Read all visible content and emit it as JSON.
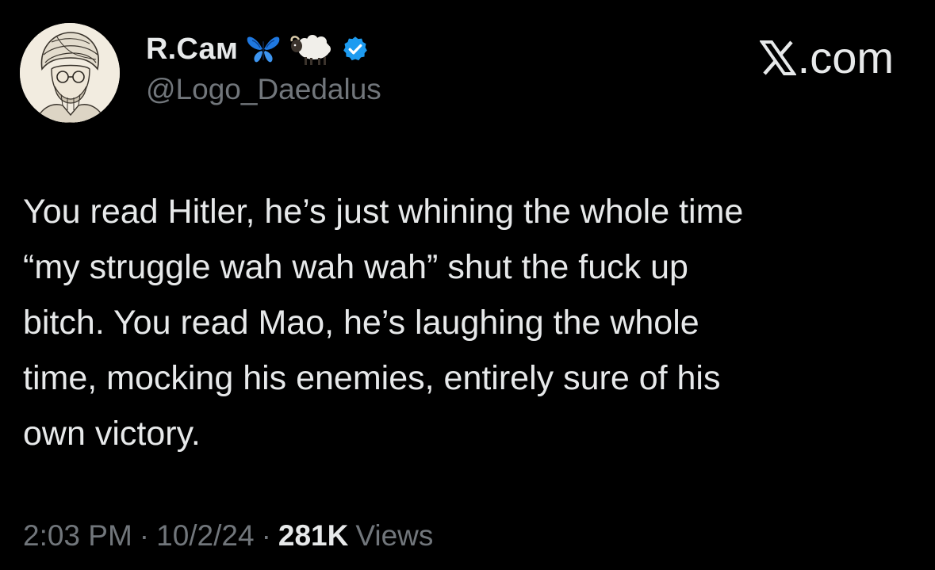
{
  "author": {
    "display_name": "R.Сам",
    "handle": "@Logo_Daedalus",
    "badges": [
      "butterfly-emoji",
      "sheep-emoji",
      "verified-badge-icon"
    ]
  },
  "brand": {
    "label": ".com",
    "icon": "x-logo-icon"
  },
  "tweet": {
    "lines": [
      "You read Hitler, he’s just whining the whole time",
      "“my struggle wah wah wah” shut the fuck up",
      "bitch. You read Mao, he’s laughing the whole",
      "time, mocking his enemies, entirely sure of his",
      "own victory."
    ]
  },
  "meta": {
    "time": "2:03 PM",
    "separator": "·",
    "date": "10/2/24",
    "views_count": "281K",
    "views_label": "Views"
  },
  "colors": {
    "background": "#000000",
    "primary_text": "#e7e9ea",
    "secondary_text": "#71767b",
    "verified_blue": "#1d9bf0"
  }
}
